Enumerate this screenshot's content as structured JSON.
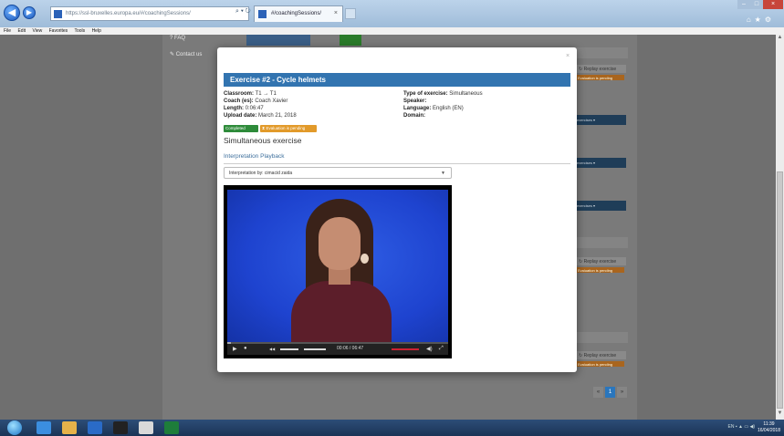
{
  "browser": {
    "address": "https://ssl-bruxelles.europa.eu/#/coachingSessions/",
    "tab_title": "#/coachingSessions/",
    "menu": [
      "File",
      "Edit",
      "View",
      "Favorites",
      "Tools",
      "Help"
    ]
  },
  "sidebar": {
    "items": [
      {
        "label": "FAQ",
        "icon": "question-icon"
      },
      {
        "label": "Contact us",
        "icon": "pencil-icon"
      }
    ]
  },
  "background": {
    "replay_label": "Replay exercise",
    "eval_label": "Evaluation is pending",
    "exercises_label": "exercises",
    "pagination": {
      "current": "1"
    }
  },
  "modal": {
    "title": "Exercise #2 - Cycle helmets",
    "fields_left": [
      {
        "label": "Classroom:",
        "value": "T1 → T1"
      },
      {
        "label": "Coach (es):",
        "value": "Coach Xavier"
      },
      {
        "label": "Length:",
        "value": "0:06:47"
      },
      {
        "label": "Upload date:",
        "value": "March 21, 2018"
      }
    ],
    "fields_right": [
      {
        "label": "Type of exercise:",
        "value": "Simultaneous"
      },
      {
        "label": "Speaker:",
        "value": ""
      },
      {
        "label": "Language:",
        "value": "English (EN)"
      },
      {
        "label": "Domain:",
        "value": ""
      }
    ],
    "badge_completed": "Completed",
    "badge_pending": "Evaluation is pending",
    "exercise_heading": "Simultaneous exercise",
    "section_title": "Interpretation Playback",
    "select_value": "Interpretation by: cimacid zaida",
    "video": {
      "time": "00:06 / 06:47",
      "progress": 0.015
    }
  },
  "taskbar": {
    "tray_lang": "EN",
    "time": "11:39",
    "date": "16/04/2018"
  },
  "colors": {
    "modal_header": "#3274b0",
    "completed": "#2e8b3a",
    "pending": "#e29a2a"
  }
}
